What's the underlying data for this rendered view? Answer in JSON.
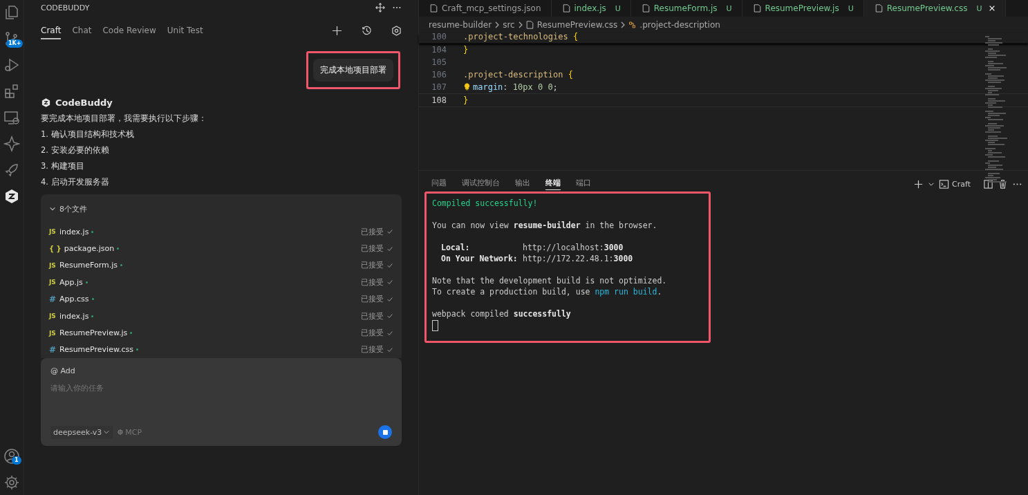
{
  "activity_bar": {
    "source_control_badge": "1K+",
    "account_badge": "1"
  },
  "panel": {
    "title": "CODEBUDDY",
    "tabs": [
      {
        "label": "Craft",
        "selected": true
      },
      {
        "label": "Chat",
        "selected": false
      },
      {
        "label": "Code Review",
        "selected": false
      },
      {
        "label": "Unit Test",
        "selected": false
      }
    ],
    "user_message": {
      "text": "完成本地项目部署",
      "highlighted": true
    },
    "assistant": {
      "name": "CodeBuddy",
      "lines": [
        "要完成本地项目部署，我需要执行以下步骤：",
        "1. 确认项目结构和技术栈",
        "2. 安装必要的依赖",
        "3. 构建项目",
        "4. 启动开发服务器"
      ]
    },
    "files": {
      "header": "8个文件",
      "expanded": true,
      "items": [
        {
          "name": "index.js",
          "kind": "js",
          "icon": "JS",
          "status": "已接受"
        },
        {
          "name": "package.json",
          "kind": "json",
          "icon": "{ }",
          "status": "已接受"
        },
        {
          "name": "ResumeForm.js",
          "kind": "js",
          "icon": "JS",
          "status": "已接受"
        },
        {
          "name": "App.js",
          "kind": "js",
          "icon": "JS",
          "status": "已接受"
        },
        {
          "name": "App.css",
          "kind": "css",
          "icon": "#",
          "status": "已接受"
        },
        {
          "name": "index.js",
          "kind": "js",
          "icon": "JS",
          "status": "已接受"
        },
        {
          "name": "ResumePreview.js",
          "kind": "js",
          "icon": "JS",
          "status": "已接受"
        },
        {
          "name": "ResumePreview.css",
          "kind": "css",
          "icon": "#",
          "status": "已接受"
        }
      ]
    },
    "input": {
      "mention": "@ Add",
      "placeholder": "请输入你的任务",
      "model": "deepseek-v3",
      "mcp": "MCP"
    }
  },
  "editor": {
    "tabs": [
      {
        "label": "Craft_mcp_settings.json",
        "selected": false
      },
      {
        "label": "index.js",
        "badge": "U",
        "selected": false
      },
      {
        "label": "ResumeForm.js",
        "badge": "U",
        "selected": false
      },
      {
        "label": "ResumePreview.js",
        "badge": "U",
        "selected": false
      },
      {
        "label": "ResumePreview.css",
        "badge": "U",
        "selected": true
      }
    ],
    "breadcrumbs": [
      "resume-builder",
      "src",
      "ResumePreview.css",
      ".project-description"
    ],
    "lines": [
      {
        "number": "100",
        "tokens": [
          {
            "kind": "selector",
            "text": ".project-technologies "
          },
          {
            "kind": "brace",
            "text": "{"
          }
        ]
      },
      {
        "number": "104",
        "tokens": [
          {
            "kind": "brace",
            "text": "}"
          }
        ]
      },
      {
        "number": "105"
      },
      {
        "number": "106",
        "tokens": [
          {
            "kind": "selector",
            "text": ".project-description "
          },
          {
            "kind": "brace",
            "text": "{"
          }
        ]
      },
      {
        "number": "107",
        "lightbulb": true,
        "tokens": [
          {
            "kind": "property",
            "text": "margin"
          },
          {
            "kind": "plain",
            "text": ": "
          },
          {
            "kind": "number",
            "text": "10px 0 0"
          },
          {
            "kind": "plain",
            "text": ";"
          }
        ]
      },
      {
        "number": "108",
        "tokens": [
          {
            "kind": "brace",
            "text": "}"
          }
        ]
      }
    ]
  },
  "bottom_panel": {
    "tabs": [
      {
        "label": "问题",
        "selected": false
      },
      {
        "label": "调试控制台",
        "selected": false
      },
      {
        "label": "输出",
        "selected": false
      },
      {
        "label": "终端",
        "selected": true
      },
      {
        "label": "端口",
        "selected": false
      }
    ],
    "terminal_name": "Craft",
    "terminal": {
      "highlighted": true,
      "blocks": [
        [
          {
            "segments": [
              {
                "kind": "success",
                "text": "Compiled successfully!"
              }
            ]
          }
        ],
        [
          {
            "segments": [
              {
                "kind": "plain",
                "text": "You can now view "
              },
              {
                "kind": "bold",
                "text": "resume-builder"
              },
              {
                "kind": "plain",
                "text": " in the browser."
              }
            ]
          }
        ],
        [
          {
            "segments": [
              {
                "kind": "label",
                "text": "Local:"
              },
              {
                "kind": "plain",
                "text": "http://localhost:"
              },
              {
                "kind": "bold",
                "text": "3000"
              }
            ]
          },
          {
            "segments": [
              {
                "kind": "label",
                "text": "On Your Network:"
              },
              {
                "kind": "plain",
                "text": "http://172.22.48.1:"
              },
              {
                "kind": "bold",
                "text": "3000"
              }
            ]
          }
        ],
        [
          {
            "segments": [
              {
                "kind": "plain",
                "text": "Note that the development build is not optimized."
              }
            ]
          },
          {
            "segments": [
              {
                "kind": "plain",
                "text": "To create a production build, use "
              },
              {
                "kind": "link",
                "text": "npm run build"
              },
              {
                "kind": "plain",
                "text": "."
              }
            ]
          }
        ],
        [
          {
            "segments": [
              {
                "kind": "plain",
                "text": "webpack compiled "
              },
              {
                "kind": "success-bold",
                "text": "successfully"
              }
            ]
          }
        ]
      ]
    }
  }
}
